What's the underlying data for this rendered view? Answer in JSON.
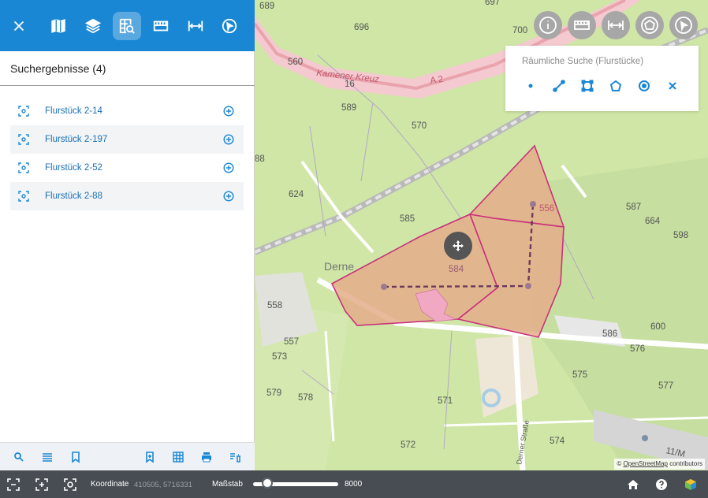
{
  "toolbar": {
    "items": [
      {
        "icon": "close-icon"
      },
      {
        "icon": "map-icon"
      },
      {
        "icon": "layers-icon"
      },
      {
        "icon": "search-plots-icon",
        "active": true
      },
      {
        "icon": "measure-area-icon"
      },
      {
        "icon": "measure-distance-icon"
      },
      {
        "icon": "select-icon"
      }
    ]
  },
  "results": {
    "title": "Suchergebnisse (4)",
    "items": [
      {
        "label": "Flurstück 2-14"
      },
      {
        "label": "Flurstück 2-197"
      },
      {
        "label": "Flurstück 2-52"
      },
      {
        "label": "Flurstück 2-88"
      }
    ]
  },
  "map": {
    "street_labels": [
      "Kamener Kreuz",
      "A 2",
      "Derne",
      "Derner Straße"
    ],
    "parcel_labels": [
      "689",
      "697",
      "696",
      "700",
      "560",
      "16",
      "589",
      "570",
      "88",
      "624",
      "585",
      "556",
      "587",
      "664",
      "598",
      "584",
      "558",
      "557",
      "573",
      "579",
      "578",
      "586",
      "576",
      "600",
      "575",
      "577",
      "571",
      "574",
      "572",
      "11/M"
    ],
    "spatial_search": {
      "title": "Räumliche Suche (Flurstücke)",
      "tools": [
        "point-icon",
        "line-icon",
        "rectangle-icon",
        "polygon-icon",
        "circle-icon",
        "close-icon"
      ]
    },
    "attribution": {
      "prefix": "©",
      "link": "OpenStreetMap",
      "suffix": "contributors"
    },
    "colors": {
      "parcel_fill": "#e4ad8a",
      "parcel_stroke": "#c8317a",
      "accent": "#1a87d4"
    }
  },
  "statusbar": {
    "coord_label": "Koordinate",
    "coord_value": "410505, 5716331",
    "scale_label": "Maßstab",
    "scale_value": "8000"
  }
}
